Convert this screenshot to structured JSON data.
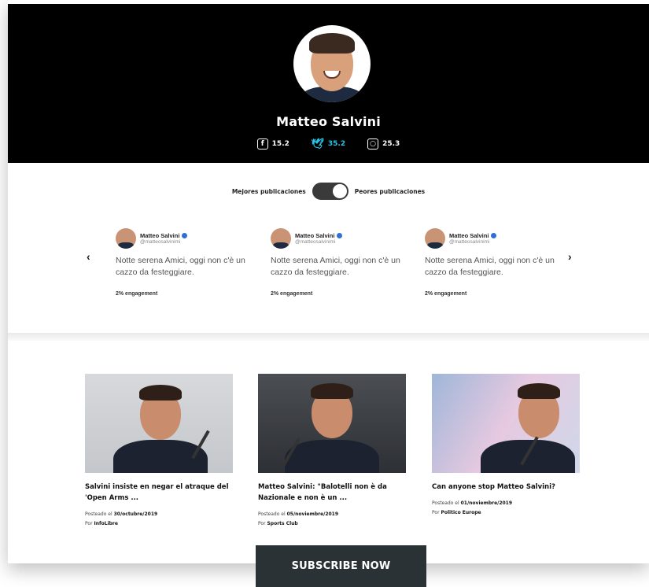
{
  "profile": {
    "name": "Matteo Salvini",
    "stats": [
      {
        "network": "facebook",
        "icon": "facebook-icon",
        "value": "15.2"
      },
      {
        "network": "twitter",
        "icon": "twitter-icon",
        "value": "35.2"
      },
      {
        "network": "instagram",
        "icon": "instagram-icon",
        "value": "25.3"
      }
    ]
  },
  "toggle": {
    "left_label": "Mejores publicaciones",
    "right_label": "Peores publicaciones",
    "state": "right"
  },
  "tweets": [
    {
      "name": "Matteo Salvini",
      "handle": "@matteosalvinimi",
      "text": "Notte serena Amici, oggi non c'è un cazzo da festeggiare.",
      "engagement": "2% engagement"
    },
    {
      "name": "Matteo Salvini",
      "handle": "@matteosalvinimi",
      "text": "Notte serena Amici, oggi non c'è un cazzo da festeggiare.",
      "engagement": "2% engagement"
    },
    {
      "name": "Matteo Salvini",
      "handle": "@matteosalvinimi",
      "text": "Notte serena Amici, oggi non c'è un cazzo da festeggiare.",
      "engagement": "2% engagement"
    }
  ],
  "articles": [
    {
      "title": "Salvini insiste en negar el atraque del 'Open Arms ...",
      "posted_prefix": "Posteado el",
      "date": "30/octubre/2019",
      "by_prefix": "Por",
      "source": "InfoLibre"
    },
    {
      "title": "Matteo Salvini: \"Balotelli non è da Nazionale e non è un ...",
      "posted_prefix": "Posteado el",
      "date": "05/noviembre/2019",
      "by_prefix": "Por",
      "source": "Sports Club"
    },
    {
      "title": "Can anyone stop Matteo Salvini?",
      "posted_prefix": "Posteado el",
      "date": "01/noviembre/2019",
      "by_prefix": "Por",
      "source": "Politico Europe"
    }
  ],
  "subscribe": {
    "label": "SUBSCRIBE NOW"
  },
  "colors": {
    "header_bg": "#000000",
    "twitter_accent": "#29c5e6",
    "subscribe_bg": "#2b3236",
    "verified": "#2f6fd6"
  }
}
